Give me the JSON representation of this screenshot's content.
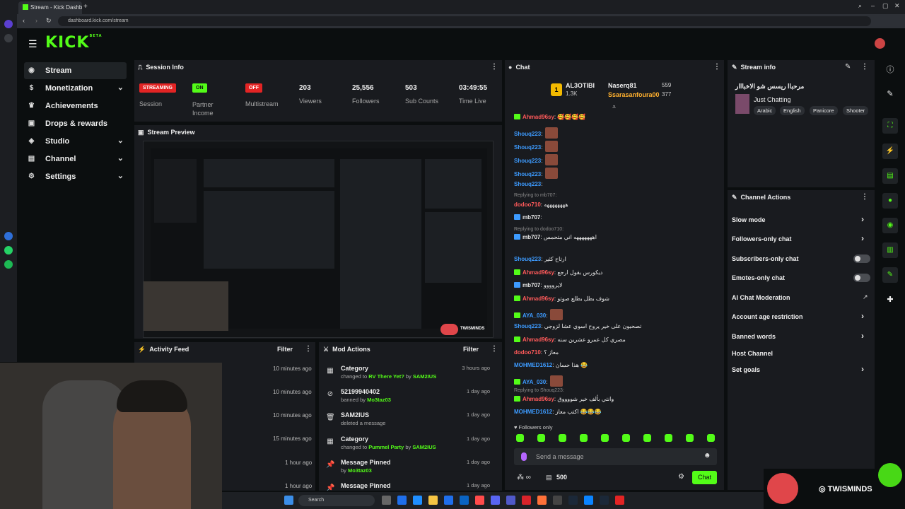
{
  "browser": {
    "tab_title": "Stream - Kick Dashboard",
    "url": "dashboard.kick.com/stream"
  },
  "header": {
    "logo": "KICK",
    "logo_tag": "BETA"
  },
  "nav": {
    "items": [
      {
        "label": "Stream",
        "icon": "stream-icon",
        "active": true
      },
      {
        "label": "Monetization",
        "icon": "dollar-icon"
      },
      {
        "label": "Achievements",
        "icon": "trophy-icon"
      },
      {
        "label": "Drops & rewards",
        "icon": "drops-icon"
      },
      {
        "label": "Studio",
        "icon": "studio-icon"
      },
      {
        "label": "Channel",
        "icon": "channel-icon"
      },
      {
        "label": "Settings",
        "icon": "gear-icon"
      }
    ]
  },
  "session": {
    "title": "Session Info",
    "streaming_badge": "STREAMING",
    "session_label": "Session",
    "partner_badge": "ON",
    "partner_label": "Partner Income",
    "multistream_badge": "OFF",
    "multistream_label": "Multistream",
    "viewers": "203",
    "viewers_label": "Viewers",
    "followers": "25,556",
    "followers_label": "Followers",
    "subs": "503",
    "subs_label": "Sub Counts",
    "time": "03:49:55",
    "time_label": "Time Live"
  },
  "preview": {
    "title": "Stream Preview"
  },
  "activity": {
    "title": "Activity Feed",
    "filter": "Filter",
    "times": [
      "10 minutes ago",
      "10 minutes ago",
      "10 minutes ago",
      "15 minutes ago",
      "1 hour ago",
      "1 hour ago"
    ]
  },
  "mod": {
    "title": "Mod Actions",
    "filter": "Filter",
    "rows": [
      {
        "icon": "category-icon",
        "title": "Category",
        "pre": "changed to ",
        "g1": "RV There Yet?",
        "mid": " by ",
        "g2": "SAM2IUS",
        "time": "3 hours ago"
      },
      {
        "icon": "ban-icon",
        "title": "52199940402",
        "pre": "banned by ",
        "g1": "Mo3taz03",
        "mid": "",
        "g2": "",
        "time": "1 day ago"
      },
      {
        "icon": "trash-icon",
        "title": "SAM2IUS",
        "pre": "deleted a message",
        "g1": "",
        "mid": "",
        "g2": "",
        "time": "1 day ago"
      },
      {
        "icon": "category-icon",
        "title": "Category",
        "pre": "changed to ",
        "g1": "Pummel Party",
        "mid": " by ",
        "g2": "SAM2IUS",
        "time": "1 day ago"
      },
      {
        "icon": "pin-icon",
        "title": "Message Pinned",
        "pre": "by ",
        "g1": "Mo3taz03",
        "mid": "",
        "g2": "",
        "time": "1 day ago"
      },
      {
        "icon": "pin-icon",
        "title": "Message Pinned",
        "pre": "",
        "g1": "",
        "mid": "",
        "g2": "",
        "time": "1 day ago"
      }
    ]
  },
  "chat": {
    "title": "Chat",
    "top_gifter": "AL3OTIBI",
    "top_gifter_count": "1.3K",
    "gifter2": "Naserq81",
    "gifter2_count": "559",
    "gifter3": "Ssarasanfoura00",
    "gifter3_count": "377",
    "messages": [
      {
        "user": "Ahmad96sy",
        "color": "red",
        "badge": "green",
        "text": ": 🥰🥰🥰🥰",
        "emote": false
      },
      {
        "user": "Shouq223",
        "color": "blue",
        "badge": "",
        "text": ":",
        "emote": true
      },
      {
        "user": "Shouq223",
        "color": "blue",
        "badge": "",
        "text": ":",
        "emote": true
      },
      {
        "user": "Shouq223",
        "color": "blue",
        "badge": "",
        "text": ":",
        "emote": true
      },
      {
        "user": "Shouq223",
        "color": "blue",
        "badge": "",
        "text": ":",
        "emote": true
      },
      {
        "user": "Shouq223",
        "color": "blue",
        "badge": "",
        "text": ":",
        "emote": false
      },
      {
        "user": "dodoo710",
        "color": "red",
        "badge": "",
        "text": ": ههههههههه",
        "emote": false
      },
      {
        "user": "mb707",
        "color": "white",
        "badge": "blue",
        "text": ":",
        "emote": false
      },
      {
        "user": "mb707",
        "color": "white",
        "badge": "blue",
        "text": ": اهههههههه اني متحمس",
        "emote": false
      },
      {
        "user": "Shouq223",
        "color": "blue",
        "badge": "",
        "text": ": ارتاح كثير",
        "emote": false
      },
      {
        "user": "Ahmad96sy",
        "color": "red",
        "badge": "green",
        "text": ": ديكورس بقول ارجع",
        "emote": false
      },
      {
        "user": "mb707",
        "color": "white",
        "badge": "blue",
        "text": ": لايروووو",
        "emote": false
      },
      {
        "user": "Ahmad96sy",
        "color": "red",
        "badge": "green",
        "text": ": شوف بطل بطلع صوتو",
        "emote": false
      },
      {
        "user": "AYA_030",
        "color": "blue",
        "badge": "green",
        "text": ":",
        "emote": true
      },
      {
        "user": "Shouq223",
        "color": "blue",
        "badge": "",
        "text": ": تصحبون على خير يروح اسوي عشا لزوجي",
        "emote": false
      },
      {
        "user": "Ahmad96sy",
        "color": "red",
        "badge": "green",
        "text": ": مصري كل عمرو عشرين سنه",
        "emote": false
      },
      {
        "user": "dodoo710",
        "color": "red",
        "badge": "",
        "text": ": معاز ؟",
        "emote": false
      },
      {
        "user": "MOHMED1612",
        "color": "blue",
        "badge": "",
        "text": ": هذا حسان 😂",
        "emote": false
      },
      {
        "user": "AYA_030",
        "color": "blue",
        "badge": "green",
        "text": ":",
        "emote": true
      },
      {
        "user": "Ahmad96sy",
        "color": "red",
        "badge": "green",
        "text": ": وانتي بألف خير شووووق",
        "emote": false
      },
      {
        "user": "MOHMED1612",
        "color": "blue",
        "badge": "",
        "text": ": اكتب معاز 😂😂😂",
        "emote": false
      }
    ],
    "replies": [
      "Replying to mb707:",
      "Replying to dodoo710:",
      "Replying to Shouq223:"
    ],
    "followers_only": "Followers only",
    "input_placeholder": "Send a message",
    "points": "500",
    "chat_button": "Chat"
  },
  "stream_info": {
    "title": "Stream info",
    "stream_title": "مرحباا ريسس شو الاخبااار",
    "category": "Just Chatting",
    "tags": [
      "Arabic",
      "English",
      "Panicore",
      "Shooter"
    ]
  },
  "channel_actions": {
    "title": "Channel Actions",
    "items": [
      "Slow mode",
      "Followers-only chat",
      "Subscribers-only chat",
      "Emotes-only chat",
      "AI Chat Moderation",
      "Account age restriction",
      "Banned words",
      "Host Channel",
      "Set goals"
    ]
  },
  "overlay": {
    "handle": "TWISMINDS",
    "preview_handle": "TWISMINDS"
  },
  "taskbar": {
    "search": "Search"
  },
  "colors": {
    "accent": "#53fc18",
    "panel": "#191b1f",
    "background": "#0b0e0f",
    "live_red": "#e32424"
  }
}
